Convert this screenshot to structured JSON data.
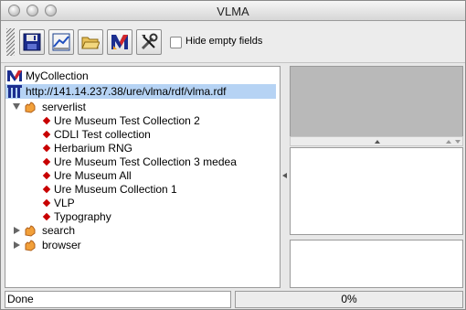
{
  "window": {
    "title": "VLMA"
  },
  "toolbar": {
    "buttons": [
      {
        "icon": "save-icon"
      },
      {
        "icon": "graph-icon"
      },
      {
        "icon": "folder-open-icon"
      },
      {
        "icon": "vlma-logo-icon"
      },
      {
        "icon": "tools-icon"
      }
    ],
    "hide_empty_label": "Hide empty fields",
    "hide_empty_checked": false
  },
  "tree": {
    "root_label": "MyCollection",
    "url_label": "http://141.14.237.38/ure/vlma/rdf/vlma.rdf",
    "serverlist_label": "serverlist",
    "servers": [
      "Ure Museum Test Collection 2",
      "CDLI Test collection",
      "Herbarium RNG",
      "Ure Museum Test Collection 3 medea",
      "Ure Museum All",
      "Ure Museum Collection 1",
      "VLP",
      "Typography"
    ],
    "search_label": "search",
    "browser_label": "browser"
  },
  "status": {
    "text": "Done"
  },
  "progress": {
    "text": "0%",
    "value": 0
  },
  "colors": {
    "selection": "#b6d3f4",
    "diamond": "#c80000",
    "preview_bg": "#b9b9b9"
  }
}
